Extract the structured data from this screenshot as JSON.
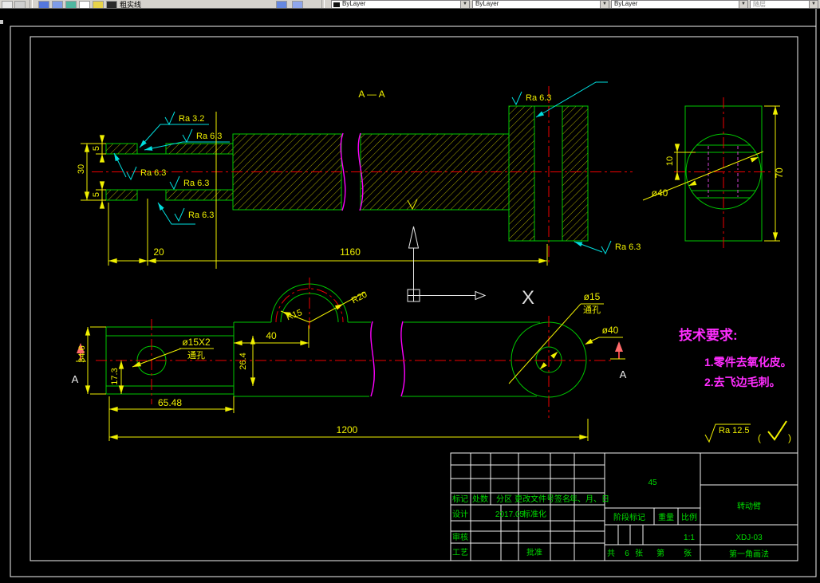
{
  "toolbar": {
    "layer_name": "粗实线",
    "color_value": "ByLayer",
    "linetype_value": "ByLayer",
    "lineweight_value": "ByLayer",
    "style_value": "随层"
  },
  "drawing": {
    "section_label": "A — A",
    "ucs_axis_label": "X",
    "section_marker": "A",
    "dims": {
      "len_overall_top": "1160",
      "len_left_step": "20",
      "height_tube": "30",
      "wall_top": "5",
      "wall_bottom": "5",
      "side_height": "70",
      "side_offset": "10",
      "side_dia": "ø40",
      "plan_width": "34.6",
      "plan_hole_offset": "17.3",
      "plan_hole_x": "65.48",
      "plan_len": "1200",
      "plan_step": "40",
      "plan_inner": "26.4",
      "arc_inner": "R15",
      "arc_outer": "R20",
      "hole_left_label": "ø15X2",
      "hole_left_note": "通孔",
      "hole_right_label": "ø15",
      "hole_right_note": "通孔",
      "boss_dia": "ø40"
    },
    "surface_finish": {
      "ra32": "Ra 3.2",
      "ra63": "Ra 6.3",
      "ra125": "Ra 12.5"
    },
    "tech_requirements": {
      "title": "技术要求:",
      "item1": "1.零件去氧化皮。",
      "item2": "2.去飞边毛刺。"
    }
  },
  "title_block": {
    "cols": [
      "标记",
      "处数",
      "分区",
      "更改文件号",
      "签名",
      "年、月、日"
    ],
    "design": "设计",
    "design_date": "2017.05",
    "standardization": "标准化",
    "review": "审核",
    "process": "工艺",
    "approve": "批准",
    "material": "45",
    "stage_mark": "阶段标记",
    "weight": "重量",
    "scale_label": "比例",
    "scale_value": "1:1",
    "sheet": [
      "共",
      "6",
      "张",
      "第",
      "张"
    ],
    "part_name": "转动臂",
    "drawing_no": "XDJ-03",
    "projection": "第一角画法"
  }
}
